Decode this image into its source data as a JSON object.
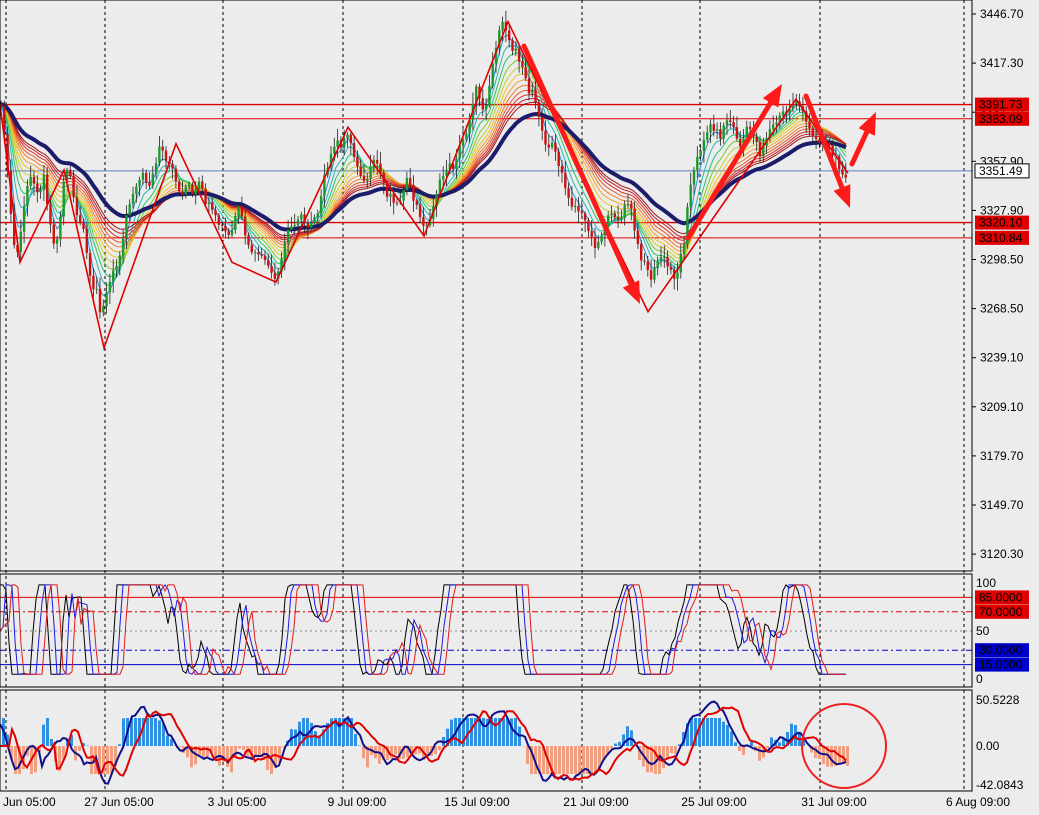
{
  "chart_data": [
    {
      "type": "candlestick",
      "pane": "main",
      "ylim": [
        3100,
        3456
      ],
      "y_ticks": [
        "3446.70",
        "3417.30",
        "3387.70",
        "3357.90",
        "3327.90",
        "3298.50",
        "3268.50",
        "3239.10",
        "3209.10",
        "3179.70",
        "3149.70",
        "3120.30"
      ],
      "x_ticks": [
        "26 Jun 05:00",
        "27 Jun 05:00",
        "3 Jul 05:00",
        "9 Jul 09:00",
        "15 Jul 09:00",
        "21 Jul 09:00",
        "25 Jul 09:00",
        "31 Jul 09:00",
        "6 Aug 09:00"
      ],
      "x_ticks_visible": [
        "Jun 05:00",
        "27 Jun 05:00",
        "3 Jul 05:00",
        "9 Jul 09:00",
        "15 Jul 09:00",
        "21 Jul 09:00",
        "25 Jul 09:00",
        "31 Jul 09:00",
        "6 Aug 09:00"
      ],
      "current_price": "3351.49",
      "horizontal_levels": [
        {
          "label": "3391.73",
          "value": 3391.73,
          "color": "#e00000"
        },
        {
          "label": "3383.09",
          "value": 3383.09,
          "color": "#e00000"
        },
        {
          "label": "3320.10",
          "value": 3320.1,
          "color": "#e00000"
        },
        {
          "label": "3310.84",
          "value": 3310.84,
          "color": "#e00000"
        }
      ],
      "price_path": [
        [
          0,
          3392
        ],
        [
          4,
          3378
        ],
        [
          8,
          3346
        ],
        [
          12,
          3318
        ],
        [
          16,
          3296
        ],
        [
          20,
          3312
        ],
        [
          24,
          3328
        ],
        [
          28,
          3344
        ],
        [
          32,
          3350
        ],
        [
          36,
          3342
        ],
        [
          40,
          3336
        ],
        [
          44,
          3352
        ],
        [
          48,
          3328
        ],
        [
          52,
          3313
        ],
        [
          56,
          3305
        ],
        [
          60,
          3322
        ],
        [
          64,
          3346
        ],
        [
          68,
          3356
        ],
        [
          72,
          3343
        ],
        [
          76,
          3326
        ],
        [
          80,
          3318
        ],
        [
          84,
          3315
        ],
        [
          88,
          3296
        ],
        [
          92,
          3276
        ],
        [
          96,
          3282
        ],
        [
          100,
          3268
        ],
        [
          104,
          3271
        ],
        [
          108,
          3280
        ],
        [
          112,
          3288
        ],
        [
          116,
          3293
        ],
        [
          120,
          3303
        ],
        [
          124,
          3316
        ],
        [
          128,
          3330
        ],
        [
          132,
          3336
        ],
        [
          136,
          3344
        ],
        [
          140,
          3346
        ],
        [
          144,
          3350
        ],
        [
          148,
          3342
        ],
        [
          152,
          3347
        ],
        [
          156,
          3356
        ],
        [
          160,
          3366
        ],
        [
          164,
          3360
        ],
        [
          168,
          3353
        ],
        [
          172,
          3356
        ],
        [
          176,
          3345
        ],
        [
          180,
          3337
        ],
        [
          184,
          3340
        ],
        [
          188,
          3344
        ],
        [
          192,
          3336
        ],
        [
          196,
          3339
        ],
        [
          200,
          3345
        ],
        [
          204,
          3334
        ],
        [
          208,
          3331
        ],
        [
          212,
          3326
        ],
        [
          216,
          3322
        ],
        [
          220,
          3318
        ],
        [
          224,
          3316
        ],
        [
          228,
          3311
        ],
        [
          232,
          3315
        ],
        [
          236,
          3326
        ],
        [
          240,
          3330
        ],
        [
          244,
          3312
        ],
        [
          248,
          3308
        ],
        [
          252,
          3300
        ],
        [
          256,
          3304
        ],
        [
          260,
          3296
        ],
        [
          264,
          3300
        ],
        [
          268,
          3294
        ],
        [
          272,
          3287
        ],
        [
          276,
          3284
        ],
        [
          280,
          3292
        ],
        [
          284,
          3306
        ],
        [
          288,
          3315
        ],
        [
          292,
          3318
        ],
        [
          296,
          3322
        ],
        [
          300,
          3325
        ],
        [
          304,
          3320
        ],
        [
          308,
          3318
        ],
        [
          312,
          3322
        ],
        [
          316,
          3326
        ],
        [
          320,
          3330
        ],
        [
          324,
          3346
        ],
        [
          328,
          3354
        ],
        [
          332,
          3363
        ],
        [
          336,
          3372
        ],
        [
          340,
          3362
        ],
        [
          344,
          3371
        ],
        [
          348,
          3376
        ],
        [
          352,
          3364
        ],
        [
          356,
          3357
        ],
        [
          360,
          3352
        ],
        [
          364,
          3344
        ],
        [
          368,
          3348
        ],
        [
          372,
          3354
        ],
        [
          376,
          3358
        ],
        [
          380,
          3351
        ],
        [
          384,
          3344
        ],
        [
          388,
          3336
        ],
        [
          392,
          3338
        ],
        [
          396,
          3330
        ],
        [
          400,
          3334
        ],
        [
          404,
          3343
        ],
        [
          408,
          3346
        ],
        [
          412,
          3336
        ],
        [
          416,
          3332
        ],
        [
          420,
          3322
        ],
        [
          424,
          3320
        ],
        [
          428,
          3316
        ],
        [
          432,
          3328
        ],
        [
          436,
          3338
        ],
        [
          440,
          3344
        ],
        [
          444,
          3350
        ],
        [
          448,
          3356
        ],
        [
          452,
          3352
        ],
        [
          456,
          3360
        ],
        [
          460,
          3366
        ],
        [
          464,
          3372
        ],
        [
          468,
          3378
        ],
        [
          472,
          3392
        ],
        [
          476,
          3401
        ],
        [
          480,
          3396
        ],
        [
          484,
          3388
        ],
        [
          488,
          3398
        ],
        [
          492,
          3414
        ],
        [
          496,
          3428
        ],
        [
          500,
          3436
        ],
        [
          504,
          3442
        ],
        [
          508,
          3433
        ],
        [
          512,
          3426
        ],
        [
          516,
          3428
        ],
        [
          520,
          3415
        ],
        [
          524,
          3412
        ],
        [
          528,
          3400
        ],
        [
          532,
          3402
        ],
        [
          536,
          3390
        ],
        [
          540,
          3382
        ],
        [
          544,
          3368
        ],
        [
          548,
          3366
        ],
        [
          552,
          3370
        ],
        [
          556,
          3362
        ],
        [
          560,
          3352
        ],
        [
          564,
          3344
        ],
        [
          568,
          3338
        ],
        [
          572,
          3331
        ],
        [
          576,
          3330
        ],
        [
          580,
          3326
        ],
        [
          584,
          3322
        ],
        [
          588,
          3318
        ],
        [
          592,
          3310
        ],
        [
          596,
          3306
        ],
        [
          600,
          3310
        ],
        [
          604,
          3318
        ],
        [
          608,
          3322
        ],
        [
          612,
          3324
        ],
        [
          616,
          3326
        ],
        [
          620,
          3320
        ],
        [
          624,
          3328
        ],
        [
          628,
          3332
        ],
        [
          632,
          3326
        ],
        [
          636,
          3310
        ],
        [
          640,
          3300
        ],
        [
          644,
          3298
        ],
        [
          648,
          3290
        ],
        [
          652,
          3286
        ],
        [
          656,
          3294
        ],
        [
          660,
          3300
        ],
        [
          664,
          3298
        ],
        [
          668,
          3293
        ],
        [
          672,
          3290
        ],
        [
          676,
          3286
        ],
        [
          680,
          3298
        ],
        [
          684,
          3308
        ],
        [
          688,
          3336
        ],
        [
          692,
          3346
        ],
        [
          696,
          3356
        ],
        [
          700,
          3364
        ],
        [
          704,
          3372
        ],
        [
          708,
          3376
        ],
        [
          712,
          3380
        ],
        [
          716,
          3376
        ],
        [
          720,
          3372
        ],
        [
          724,
          3379
        ],
        [
          728,
          3384
        ],
        [
          732,
          3379
        ],
        [
          736,
          3374
        ],
        [
          740,
          3366
        ],
        [
          744,
          3372
        ],
        [
          748,
          3378
        ],
        [
          752,
          3376
        ],
        [
          756,
          3370
        ],
        [
          760,
          3362
        ],
        [
          764,
          3368
        ],
        [
          768,
          3375
        ],
        [
          772,
          3378
        ],
        [
          776,
          3381
        ],
        [
          780,
          3384
        ],
        [
          784,
          3388
        ],
        [
          788,
          3386
        ],
        [
          792,
          3392
        ],
        [
          796,
          3395
        ],
        [
          800,
          3390
        ],
        [
          804,
          3384
        ],
        [
          808,
          3378
        ],
        [
          812,
          3374
        ],
        [
          816,
          3373
        ],
        [
          820,
          3368
        ],
        [
          824,
          3372
        ],
        [
          828,
          3368
        ],
        [
          832,
          3362
        ],
        [
          836,
          3358
        ],
        [
          840,
          3354
        ],
        [
          844,
          3350
        ],
        [
          848,
          3348
        ]
      ]
    },
    {
      "type": "line",
      "pane": "oscillator",
      "y_ticks": [
        "100",
        "50",
        "0"
      ],
      "levels": [
        {
          "label": "85.0000",
          "value": 85,
          "color": "#e00000",
          "style": "solid"
        },
        {
          "label": "70.0000",
          "value": 70,
          "color": "#e00000",
          "style": "dashdot"
        },
        {
          "label": "30.0000",
          "value": 30,
          "color": "#0000cc",
          "style": "dashdot"
        },
        {
          "label": "15.0000",
          "value": 15,
          "color": "#0000cc",
          "style": "solid"
        }
      ]
    },
    {
      "type": "bar",
      "pane": "macd",
      "y_ticks": [
        "50.5228",
        "0.00",
        "-42.0843"
      ],
      "ylim": [
        -42.0843,
        50.5228
      ]
    }
  ]
}
